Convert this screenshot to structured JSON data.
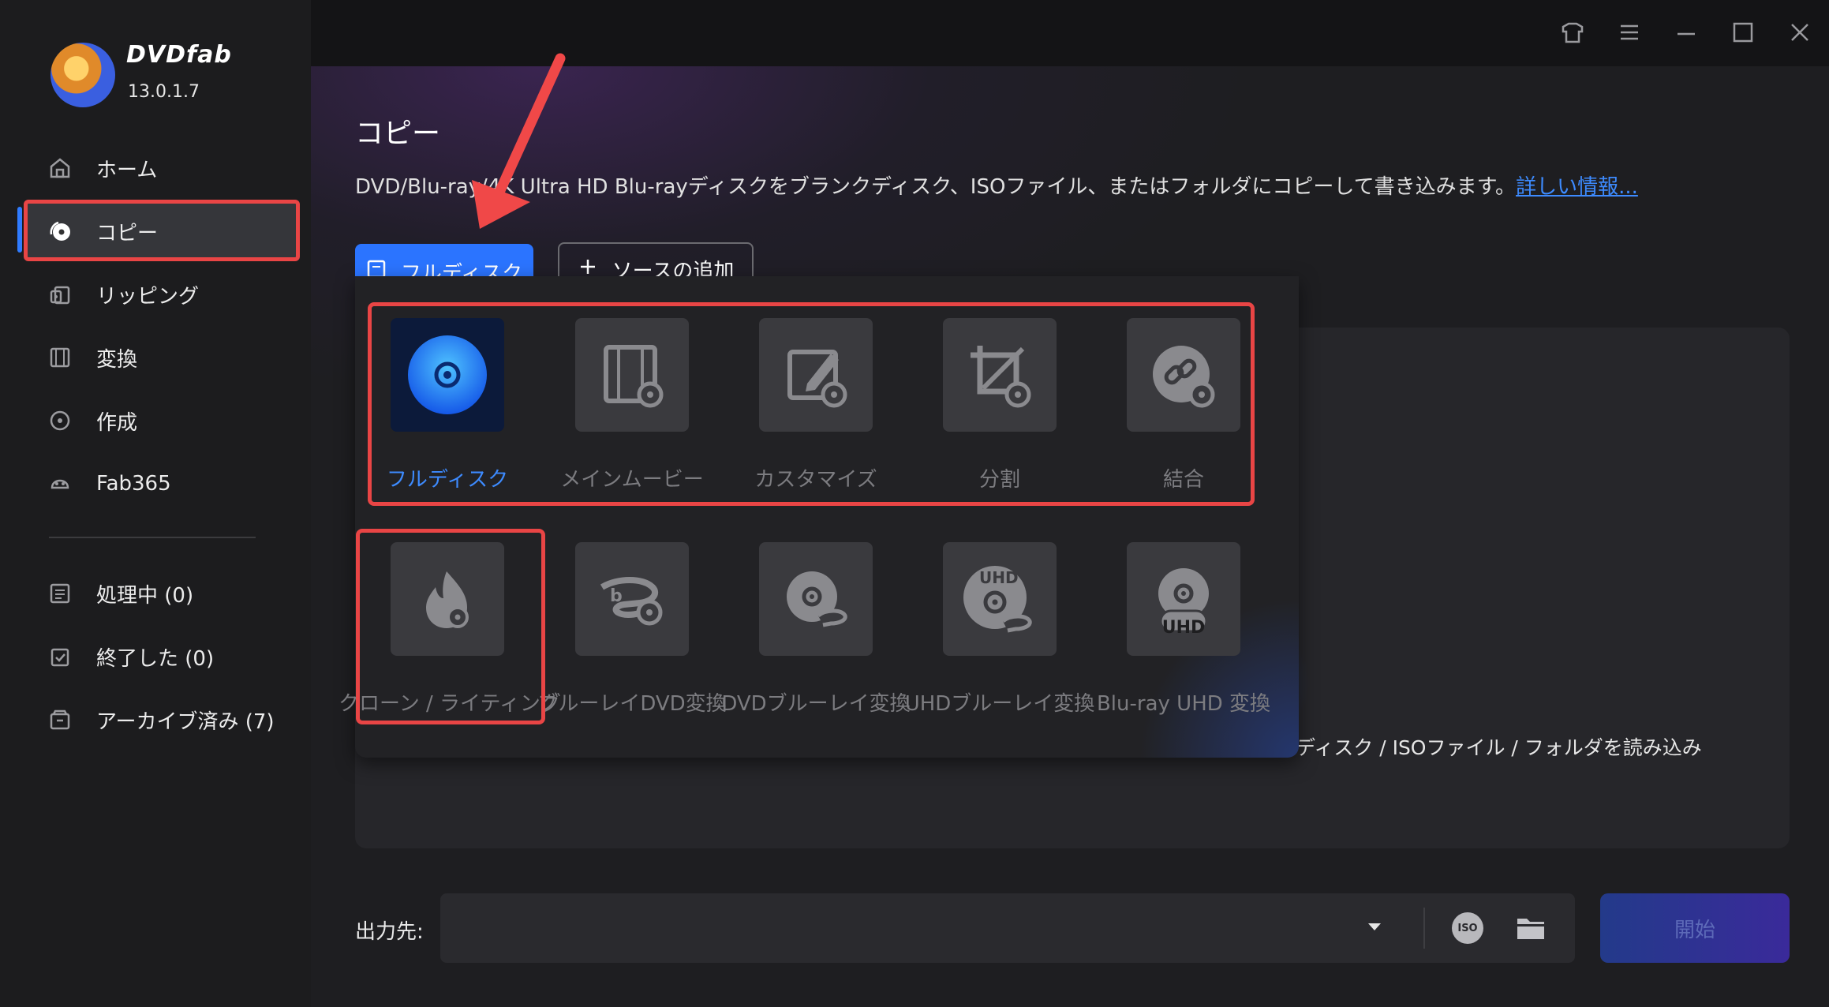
{
  "app": {
    "brand": "DVDfab",
    "version": "13.0.1.7"
  },
  "window_controls": [
    "shirt-icon",
    "menu-icon",
    "minimize-icon",
    "maximize-icon",
    "close-icon"
  ],
  "sidebar": {
    "items": [
      {
        "label": "ホーム",
        "icon": "home-icon"
      },
      {
        "label": "コピー",
        "icon": "copy-disc-icon",
        "active": true
      },
      {
        "label": "リッピング",
        "icon": "ripping-icon"
      },
      {
        "label": "変換",
        "icon": "film-icon"
      },
      {
        "label": "作成",
        "icon": "create-disc-icon"
      },
      {
        "label": "Fab365",
        "icon": "fab365-icon"
      }
    ],
    "queue": [
      {
        "label": "処理中 (0)",
        "icon": "processing-icon"
      },
      {
        "label": "終了した (0)",
        "icon": "finished-icon"
      },
      {
        "label": "アーカイブ済み (7)",
        "icon": "archive-icon"
      }
    ]
  },
  "main": {
    "title": "コピー",
    "description": "DVD/Blu-ray/4K Ultra HD Blu-rayディスクをブランクディスク、ISOファイル、またはフォルダにコピーして書き込みます。",
    "more_link": "詳しい情報...",
    "mode_button": "フルディスク",
    "add_source_button": "ソースの追加",
    "load_hint": "ディスク / ISOファイル / フォルダを読み込み"
  },
  "modes_row1": [
    {
      "label": "フルディスク",
      "icon": "full-disc-icon",
      "active": true
    },
    {
      "label": "メインムービー",
      "icon": "main-movie-icon"
    },
    {
      "label": "カスタマイズ",
      "icon": "customize-icon"
    },
    {
      "label": "分割",
      "icon": "split-icon"
    },
    {
      "label": "結合",
      "icon": "merge-icon"
    }
  ],
  "modes_row2": [
    {
      "label": "クローン / ライティング",
      "icon": "clone-burn-icon"
    },
    {
      "label": "ブルーレイDVD変換",
      "icon": "bluray-to-dvd-icon"
    },
    {
      "label": "DVDブルーレイ変換",
      "icon": "dvd-to-bluray-icon"
    },
    {
      "label": "UHDブルーレイ変換",
      "icon": "uhd-to-bluray-icon"
    },
    {
      "label": "Blu-ray UHD 変換",
      "icon": "bluray-to-uhd-icon"
    }
  ],
  "uhd_badge": "UHD",
  "output": {
    "label": "出力先:",
    "value": "",
    "iso_badge": "ISO",
    "start_button": "開始"
  },
  "colors": {
    "accent": "#2b74ff",
    "highlight": "#e94545",
    "link": "#3d8bff"
  }
}
